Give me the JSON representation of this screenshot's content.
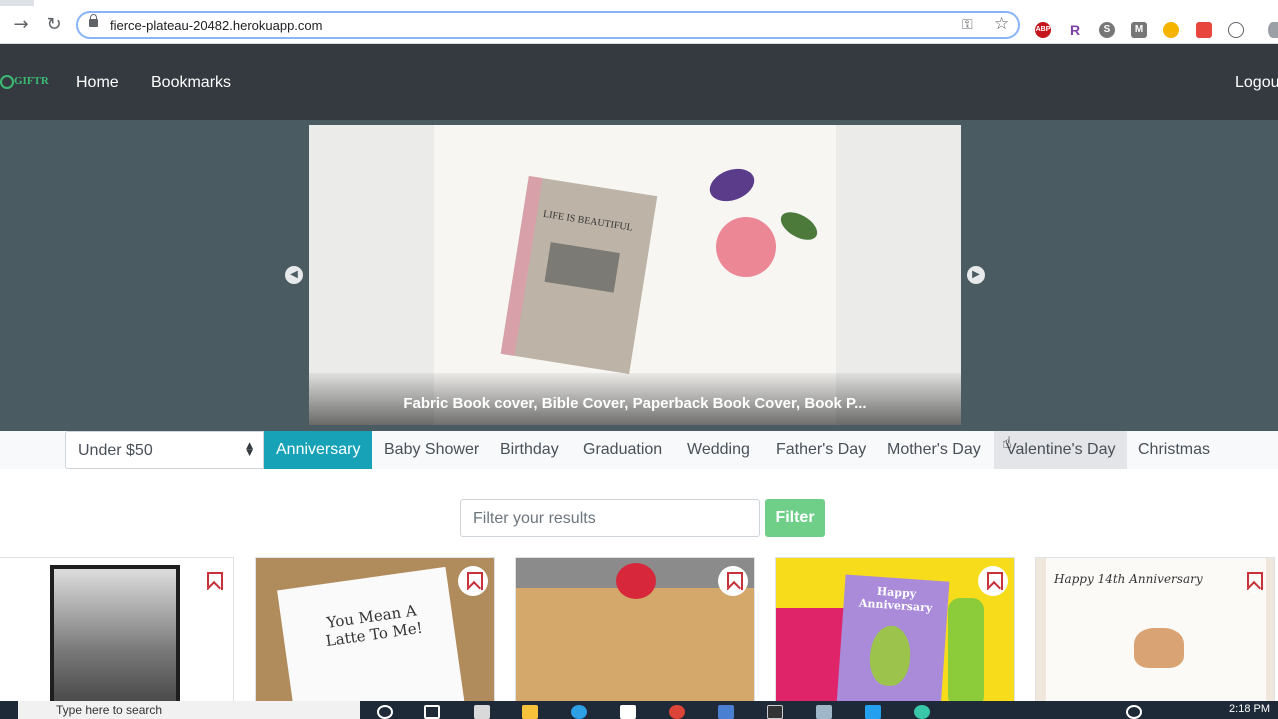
{
  "browser": {
    "url": "fierce-plateau-20482.herokuapp.com",
    "icons": [
      "forward-icon",
      "reload-icon",
      "lock-icon",
      "key-icon",
      "star-icon"
    ],
    "extensions": [
      "ABP",
      "R",
      "S",
      "M",
      "",
      "",
      ""
    ]
  },
  "nav": {
    "logo_text": "GIFTR",
    "home": "Home",
    "bookmarks": "Bookmarks",
    "logout": "Logou"
  },
  "carousel": {
    "caption": "Fabric Book cover, Bible Cover, Paperback Book Cover, Book P...",
    "book_title": "LIFE IS BEAUTIFUL",
    "prev_icon": "chevron-left-icon",
    "next_icon": "chevron-right-icon"
  },
  "filters": {
    "price": "Under $50",
    "categories": [
      "Anniversary",
      "Baby Shower",
      "Birthday",
      "Graduation",
      "Wedding",
      "Father's Day",
      "Mother's Day",
      "Valentine's Day",
      "Christmas"
    ],
    "active_category": "Anniversary",
    "search_placeholder": "Filter your results",
    "filter_button": "Filter"
  },
  "cards": [
    {
      "text": ""
    },
    {
      "text": "You Mean A Latte To Me!"
    },
    {
      "text": ""
    },
    {
      "text": "Happy Anniversary"
    },
    {
      "text": "Happy 14th Anniversary"
    }
  ],
  "taskbar": {
    "search_placeholder": "Type here to search",
    "time": "2:18 PM"
  },
  "colors": {
    "navbar": "#343a40",
    "hero": "#4a5b62",
    "active_tab": "#17a2b8",
    "filter_button": "#6fcf88",
    "bookmark": "#c8313a"
  }
}
